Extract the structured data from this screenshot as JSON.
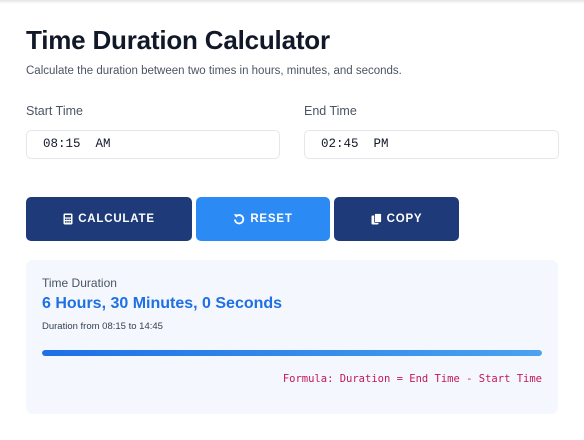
{
  "header": {
    "title": "Time Duration Calculator",
    "subtitle": "Calculate the duration between two times in hours, minutes, and seconds."
  },
  "inputs": {
    "start": {
      "label": "Start Time",
      "value": "08:15  AM"
    },
    "end": {
      "label": "End Time",
      "value": "02:45  PM"
    }
  },
  "buttons": {
    "calculate": {
      "label": "CALCULATE",
      "icon": "calculator-icon"
    },
    "reset": {
      "label": "RESET",
      "icon": "undo-icon"
    },
    "copy": {
      "label": "COPY",
      "icon": "copy-icon"
    }
  },
  "result": {
    "label": "Time Duration",
    "value": "6 Hours, 30 Minutes, 0 Seconds",
    "detail": "Duration from 08:15 to 14:45",
    "progress": 1.0,
    "formula": "Formula: Duration = End Time - Start Time"
  },
  "colors": {
    "primary": "#1e3a78",
    "accent": "#2b8af4",
    "result_text": "#1f6fe5",
    "formula_text": "#c2185b",
    "result_bg": "#f4f7fd"
  }
}
